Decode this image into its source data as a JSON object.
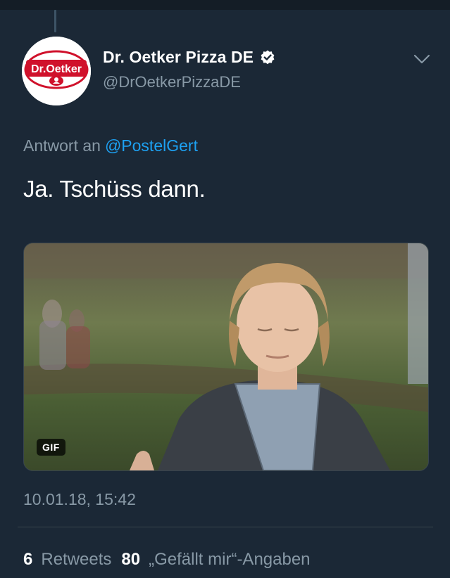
{
  "tweet": {
    "author": {
      "display_name": "Dr. Oetker Pizza DE",
      "handle": "@DrOetkerPizzaDE",
      "avatar_logo_text": "Dr.Oetker",
      "verified": true
    },
    "reply_to": {
      "prefix": "Antwort an",
      "mention": "@PostelGert"
    },
    "text": "Ja. Tschüss dann.",
    "media": {
      "type_badge": "GIF"
    },
    "timestamp": "10.01.18, 15:42",
    "stats": {
      "retweets_count": "6",
      "retweets_label": "Retweets",
      "likes_count": "80",
      "likes_label": "„Gefällt mir“-Angaben"
    }
  },
  "icons": [
    "verified-badge-icon",
    "chevron-down-icon"
  ],
  "colors": {
    "background": "#1b2836",
    "secondary_text": "#8899a6",
    "link": "#1da1f2",
    "divider": "#38444d",
    "brand_red": "#d0112b"
  }
}
